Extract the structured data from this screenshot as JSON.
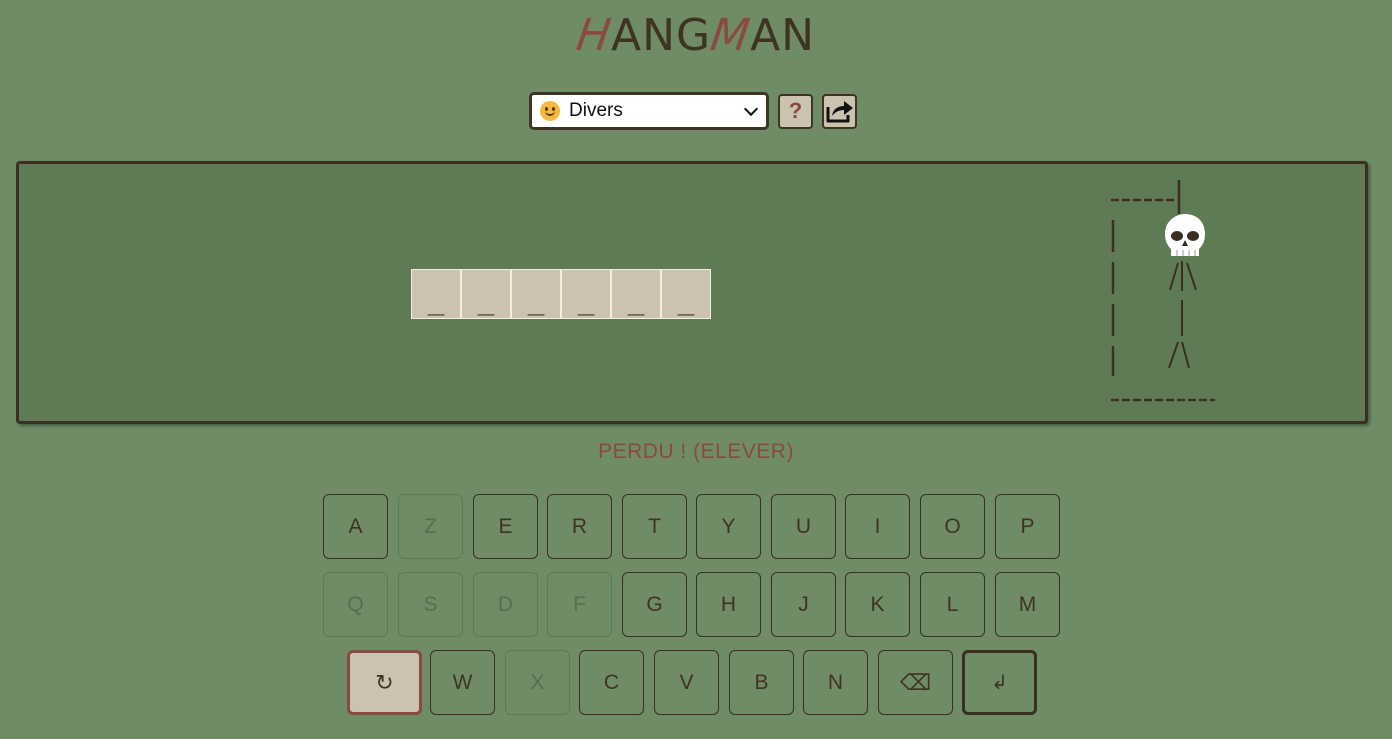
{
  "title": {
    "parts": [
      {
        "text": "H",
        "accent": true
      },
      {
        "text": "ANG",
        "accent": false
      },
      {
        "text": "M",
        "accent": true
      },
      {
        "text": "AN",
        "accent": false
      }
    ]
  },
  "controls": {
    "category_icon": "smiley-face-icon",
    "category_value": "Divers",
    "help_label": "?",
    "share_icon": "share-icon"
  },
  "word": {
    "letters": [
      "_",
      "_",
      "_",
      "_",
      "_",
      "_"
    ]
  },
  "status": "PERDU ! (ELEVER)",
  "keyboard": {
    "row1": [
      {
        "label": "A",
        "used": false
      },
      {
        "label": "Z",
        "used": true
      },
      {
        "label": "E",
        "used": false
      },
      {
        "label": "R",
        "used": false
      },
      {
        "label": "T",
        "used": false
      },
      {
        "label": "Y",
        "used": false
      },
      {
        "label": "U",
        "used": false
      },
      {
        "label": "I",
        "used": false
      },
      {
        "label": "O",
        "used": false
      },
      {
        "label": "P",
        "used": false
      }
    ],
    "row2": [
      {
        "label": "Q",
        "used": true
      },
      {
        "label": "S",
        "used": true
      },
      {
        "label": "D",
        "used": true
      },
      {
        "label": "F",
        "used": true
      },
      {
        "label": "G",
        "used": false
      },
      {
        "label": "H",
        "used": false
      },
      {
        "label": "J",
        "used": false
      },
      {
        "label": "K",
        "used": false
      },
      {
        "label": "L",
        "used": false
      },
      {
        "label": "M",
        "used": false
      }
    ],
    "row3": [
      {
        "label": "↻",
        "type": "restart",
        "used": false
      },
      {
        "label": "W",
        "used": false
      },
      {
        "label": "X",
        "used": true
      },
      {
        "label": "C",
        "used": false
      },
      {
        "label": "V",
        "used": false
      },
      {
        "label": "B",
        "used": false
      },
      {
        "label": "N",
        "used": false
      },
      {
        "label": "⌫",
        "type": "backspace",
        "used": false
      },
      {
        "label": "↲",
        "type": "enter",
        "used": false
      }
    ]
  },
  "colors": {
    "background": "#6f8c66",
    "board": "#5f7b56",
    "ink": "#3f3324",
    "accent": "#8a4a44",
    "tile": "#cbc2af"
  }
}
